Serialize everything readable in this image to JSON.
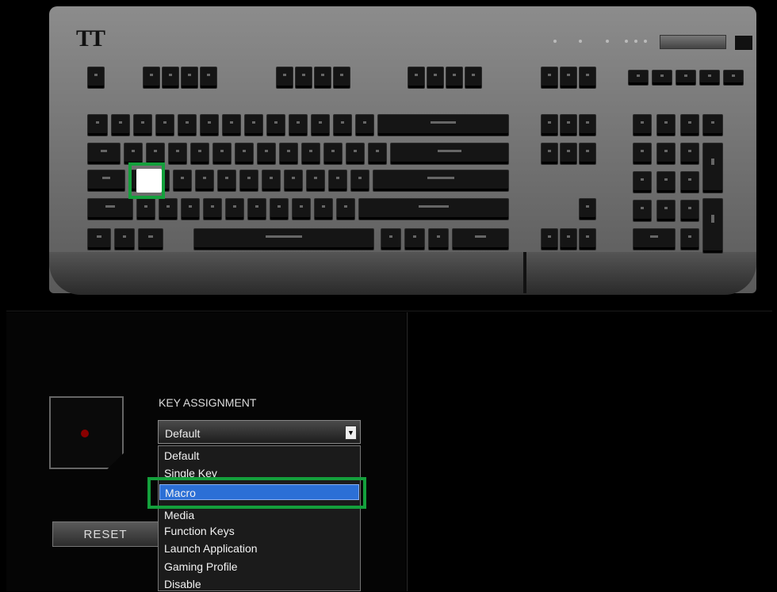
{
  "keyboard": {
    "brand": "TT",
    "selected_key": "A"
  },
  "panel": {
    "key_assignment_label": "KEY ASSIGNMENT",
    "selected_value": "Default",
    "options": [
      "Default",
      "Single Key",
      "Macro",
      "Media",
      "Function Keys",
      "Launch Application",
      "Gaming Profile",
      "Disable"
    ],
    "highlighted_option": "Macro",
    "reset_label": "RESET"
  },
  "colors": {
    "highlight": "#14a03c",
    "selection": "#2b6fd6"
  }
}
